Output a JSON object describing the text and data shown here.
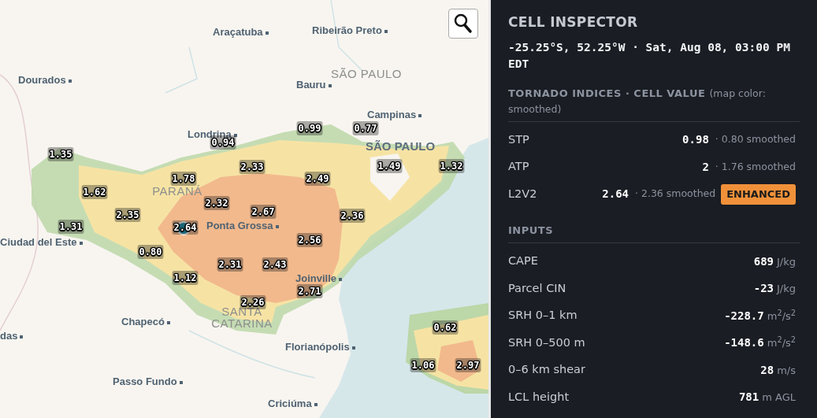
{
  "map": {
    "places": [
      {
        "name": "Araçatuba",
        "kind": "city"
      },
      {
        "name": "Ribeirão Preto",
        "kind": "city"
      },
      {
        "name": "SÃO PAULO",
        "kind": "state"
      },
      {
        "name": "Dourados",
        "kind": "city"
      },
      {
        "name": "Bauru",
        "kind": "city"
      },
      {
        "name": "Campinas",
        "kind": "city"
      },
      {
        "name": "Londrina",
        "kind": "city"
      },
      {
        "name": "SÃO PAULO",
        "kind": "capital"
      },
      {
        "name": "PARANÁ",
        "kind": "state"
      },
      {
        "name": "Ponta Grossa",
        "kind": "city"
      },
      {
        "name": "Ciudad del Este",
        "kind": "city"
      },
      {
        "name": "Joinville",
        "kind": "city"
      },
      {
        "name": "Chapecó",
        "kind": "city"
      },
      {
        "name": "SANTA CATARINA",
        "kind": "state"
      },
      {
        "name": "das",
        "kind": "city"
      },
      {
        "name": "Florianópolis",
        "kind": "city"
      },
      {
        "name": "Passo Fundo",
        "kind": "city"
      },
      {
        "name": "Criciúma",
        "kind": "city"
      }
    ],
    "values": [
      {
        "text": "0.99",
        "selected": false
      },
      {
        "text": "0.77",
        "selected": false
      },
      {
        "text": "0.94",
        "selected": false
      },
      {
        "text": "1.35",
        "selected": false
      },
      {
        "text": "2.33",
        "selected": false
      },
      {
        "text": "1.49",
        "selected": false
      },
      {
        "text": "1.32",
        "selected": false
      },
      {
        "text": "1.78",
        "selected": false
      },
      {
        "text": "2.49",
        "selected": false
      },
      {
        "text": "1.62",
        "selected": false
      },
      {
        "text": "2.32",
        "selected": false
      },
      {
        "text": "2.35",
        "selected": false
      },
      {
        "text": "2.67",
        "selected": false
      },
      {
        "text": "2.36",
        "selected": false
      },
      {
        "text": "1.31",
        "selected": false
      },
      {
        "text": "2.64",
        "selected": true
      },
      {
        "text": "2.56",
        "selected": false
      },
      {
        "text": "0.80",
        "selected": false
      },
      {
        "text": "2.31",
        "selected": false
      },
      {
        "text": "2.43",
        "selected": false
      },
      {
        "text": "1.12",
        "selected": false
      },
      {
        "text": "2.71",
        "selected": false
      },
      {
        "text": "2.26",
        "selected": false
      },
      {
        "text": "0.62",
        "selected": false
      },
      {
        "text": "1.06",
        "selected": false
      },
      {
        "text": "2.97",
        "selected": false
      }
    ]
  },
  "inspector": {
    "title": "CELL INSPECTOR",
    "location": "-25.25°S, 52.25°W · Sat, Aug 08, 03:00 PM EDT",
    "sections": [
      {
        "heading": "TORNADO INDICES · CELL VALUE",
        "note": "(map color: smoothed)",
        "rows": [
          {
            "label": "STP",
            "value": "0.98",
            "smoothed": "· 0.80 smoothed"
          },
          {
            "label": "ATP",
            "value": "2",
            "smoothed": "· 1.76 smoothed"
          },
          {
            "label": "L2V2",
            "value": "2.64",
            "smoothed": "· 2.36 smoothed",
            "badge": "ENHANCED"
          }
        ]
      },
      {
        "heading": "INPUTS",
        "rows": [
          {
            "label": "CAPE",
            "value": "689",
            "unit": "J/kg"
          },
          {
            "label": "Parcel CIN",
            "value": "-23",
            "unit": "J/kg"
          },
          {
            "label": "SRH 0–1 km",
            "value": "-228.7",
            "unit": "m$^{2}$/s$^{2}$"
          },
          {
            "label": "SRH 0–500 m",
            "value": "-148.6",
            "unit": "m$^{2}$/s$^{2}$"
          },
          {
            "label": "0–6 km shear",
            "value": "28",
            "unit": "m/s"
          },
          {
            "label": "LCL height",
            "value": "781",
            "unit": "m AGL"
          }
        ]
      }
    ]
  }
}
